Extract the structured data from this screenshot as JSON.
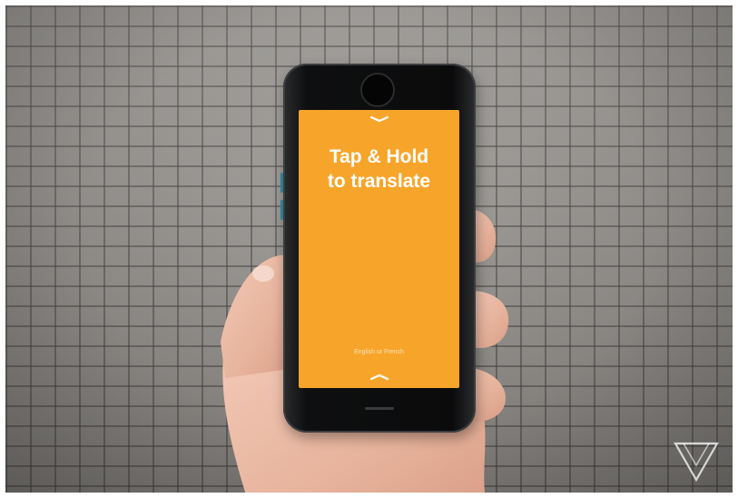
{
  "screen": {
    "title_line1": "Tap & Hold",
    "title_line2": "to translate",
    "language_hint": "English or French",
    "background_color": "#f7a52a",
    "text_color": "#ffffff"
  },
  "icons": {
    "top": "chevron-down-icon",
    "bottom": "chevron-up-icon",
    "watermark": "verge-logo-icon"
  },
  "scene": {
    "ground": "gray brick pavement",
    "hand": "hand holding phone"
  }
}
